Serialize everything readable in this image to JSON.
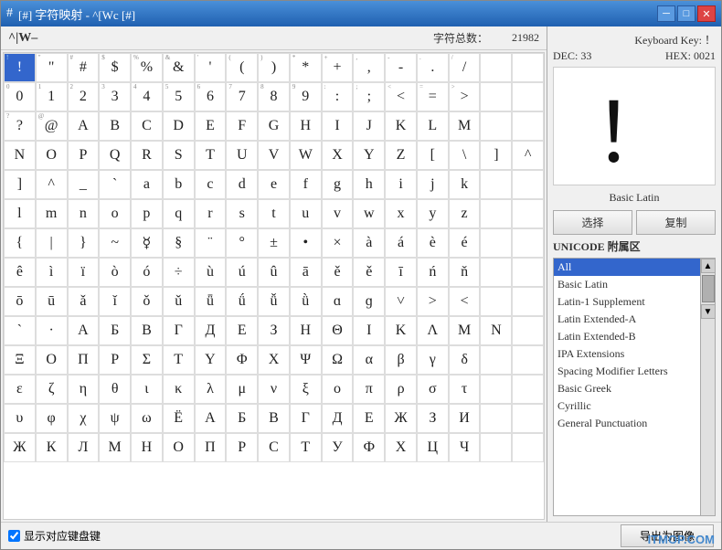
{
  "window": {
    "title": "[#] 字符映射 - ^[Wc [#]",
    "icon": "#"
  },
  "top_bar": {
    "font_name": "^|W–",
    "char_count_label": "字符总数：",
    "char_count_value": "21982"
  },
  "right_panel": {
    "keyboard_key_label": "Keyboard Key: ！",
    "dec_label": "DEC: 33",
    "hex_label": "HEX: 0021",
    "glyph_char": "！",
    "block_name": "Basic Latin",
    "select_btn": "选择",
    "copy_btn": "复制",
    "unicode_section_title": "UNICODE 附属区"
  },
  "unicode_blocks": [
    {
      "id": "all",
      "label": "All",
      "selected": true
    },
    {
      "id": "basic-latin",
      "label": "Basic Latin",
      "selected": false
    },
    {
      "id": "latin-1-supplement",
      "label": "Latin-1 Supplement",
      "selected": false
    },
    {
      "id": "latin-extended-a",
      "label": "Latin Extended-A",
      "selected": false
    },
    {
      "id": "latin-extended-b",
      "label": "Latin Extended-B",
      "selected": false
    },
    {
      "id": "ipa-extensions",
      "label": "IPA Extensions",
      "selected": false
    },
    {
      "id": "spacing-modifier-letters",
      "label": "Spacing Modifier Letters",
      "selected": false
    },
    {
      "id": "basic-greek",
      "label": "Basic Greek",
      "selected": false
    },
    {
      "id": "cyrillic",
      "label": "Cyrillic",
      "selected": false
    },
    {
      "id": "general-punctuation",
      "label": "General Punctuation",
      "selected": false
    }
  ],
  "bottom_bar": {
    "checkbox_label": "显示对应键盘键",
    "export_btn_label": "导出为图像"
  },
  "chars_row1": [
    "!",
    "\"",
    "#",
    "$",
    "%",
    "&",
    "'",
    "(",
    ")",
    "*",
    "+",
    ",",
    "-",
    ".",
    "/",
    " ",
    " "
  ],
  "chars_row2": [
    "0",
    "1",
    "2",
    "3",
    "4",
    "5",
    "6",
    "7",
    "8",
    "9",
    ":",
    ";",
    "<",
    "=",
    ">",
    " ",
    " "
  ],
  "chars_row3": [
    "?",
    "@",
    "A",
    "B",
    "C",
    "D",
    "E",
    "F",
    "G",
    "H",
    "I",
    "J",
    "K",
    "L",
    "M",
    " ",
    " "
  ],
  "chars_row4": [
    "N",
    "O",
    "P",
    "Q",
    "R",
    "S",
    "T",
    "U",
    "V",
    "W",
    "X",
    "Y",
    "Z",
    "[",
    "\\",
    "]",
    "^"
  ],
  "chars_row5": [
    "]",
    "^",
    "_",
    "`",
    "a",
    "b",
    "c",
    "d",
    "e",
    "f",
    "g",
    "h",
    "i",
    "j",
    "k",
    " ",
    " "
  ],
  "chars_row6": [
    "l",
    "m",
    "n",
    "o",
    "p",
    "q",
    "r",
    "s",
    "t",
    "u",
    "v",
    "w",
    "x",
    "y",
    "z",
    " ",
    " "
  ],
  "chars_row7": [
    "{",
    "|",
    "}",
    "~",
    "☿",
    "§",
    "¨",
    "°",
    "±",
    "•",
    "×",
    "à",
    "á",
    "è",
    "é",
    " ",
    " "
  ],
  "chars_row8": [
    "ê",
    "ì",
    "ï",
    "ò",
    "ó",
    "÷",
    "ù",
    "ú",
    "û",
    "ā",
    "ě",
    "ě",
    "ī",
    "ń",
    "ň",
    " ",
    " "
  ],
  "chars_row9": [
    "ō",
    "ū",
    "ǎ",
    "ǐ",
    "ǒ",
    "ǔ",
    "ǖ",
    "ǘ",
    "ǚ",
    "ǜ",
    "ɑ",
    "ɡ",
    "˅",
    "˃",
    "˂",
    " ",
    " "
  ],
  "chars_row10": [
    "`",
    "·",
    "А",
    "Б",
    "В",
    "Г",
    "Д",
    "Е",
    "З",
    "Η",
    "Θ",
    "Ι",
    "Κ",
    "Λ",
    "Μ",
    "Ν",
    " "
  ],
  "chars_row11": [
    "Ξ",
    "Ο",
    "Π",
    "Ρ",
    "Σ",
    "Τ",
    "Υ",
    "Φ",
    "Χ",
    "Ψ",
    "Ω",
    "α",
    "β",
    "γ",
    "δ",
    " ",
    " "
  ],
  "chars_row12": [
    "ε",
    "ζ",
    "η",
    "θ",
    "ι",
    "κ",
    "λ",
    "μ",
    "ν",
    "ξ",
    "ο",
    "π",
    "ρ",
    "σ",
    "τ",
    " ",
    " "
  ],
  "chars_row13": [
    "υ",
    "φ",
    "χ",
    "ψ",
    "ω",
    "Ё",
    "А",
    "Б",
    "В",
    "Г",
    "Д",
    "Е",
    "Ж",
    "З",
    "И",
    " ",
    " "
  ],
  "chars_row14": [
    "Ж",
    "К",
    "Л",
    "М",
    "Н",
    "О",
    "П",
    "Р",
    "С",
    "Т",
    "У",
    "Ф",
    "Х",
    "Ц",
    "Ч",
    " ",
    " "
  ],
  "watermark": "ITMOP.COM"
}
